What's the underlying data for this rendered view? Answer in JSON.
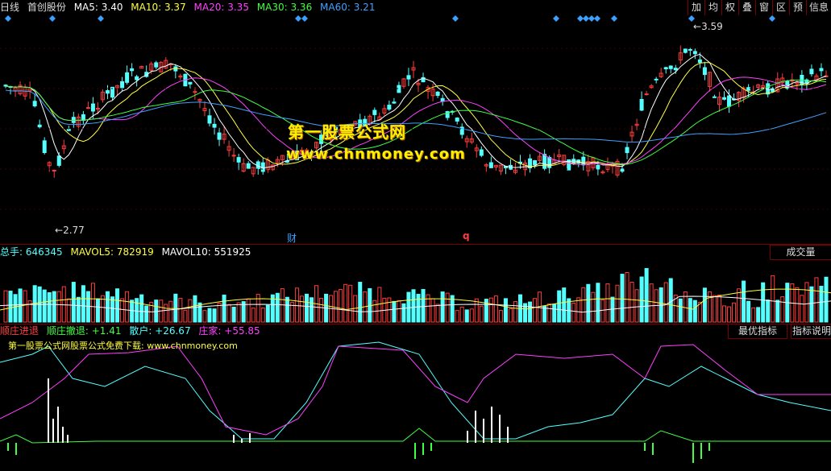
{
  "kline_header": {
    "period": "日线",
    "stock_name": "首创股份",
    "ma5": "MA5: 3.40",
    "ma10": "MA10: 3.37",
    "ma20": "MA20: 3.35",
    "ma30": "MA30: 3.36",
    "ma60": "MA60: 3.21"
  },
  "toolbar": [
    "加",
    "均",
    "权",
    "叠",
    "窗",
    "区",
    "预",
    "信息"
  ],
  "price_annotations": {
    "high": "3.59",
    "low": "2.77"
  },
  "event_markers": {
    "cai": "财",
    "q": "q"
  },
  "volume_header": {
    "total": "总手: 646345",
    "mavol5": "MAVOL5: 782919",
    "mavol10": "MAVOL10: 551925",
    "tab": "成交量"
  },
  "indicator_header": {
    "name": "顺庄进退",
    "line1": "顺庄撤退: +1.41",
    "line2": "散户: +26.67",
    "line3": "庄家: +55.85",
    "tab_best": "最优指标",
    "tab_explain": "指标说明",
    "caption": "第一股票公式网股票公式免费下载: www.chnmoney.com"
  },
  "watermark": {
    "title": "第一股票公式网",
    "url": "www.chnmoney.com"
  },
  "colors": {
    "up": "#ff3c3c",
    "down": "#54ffff",
    "ma5": "#ffffff",
    "ma10": "#ffff40",
    "ma20": "#ff40ff",
    "ma30": "#40ff40",
    "ma60": "#40a0ff",
    "border": "#7a0000",
    "diamond": "#3ca0ff"
  }
}
